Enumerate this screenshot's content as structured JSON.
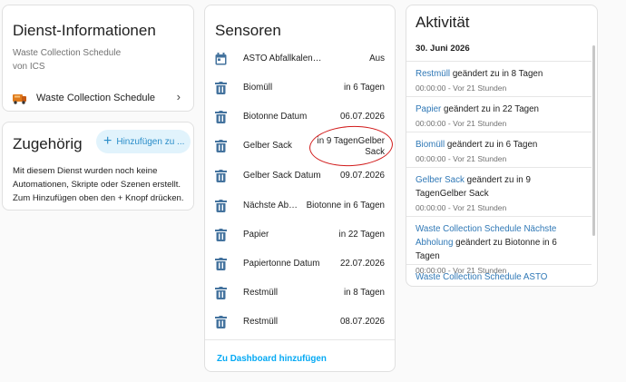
{
  "service_card": {
    "title": "Dienst-Informationen",
    "integration": "Waste Collection Schedule",
    "provider": "von ICS",
    "entry_label": "Waste Collection Schedule"
  },
  "related_card": {
    "title": "Zugehörig",
    "add_button": "Hinzufügen zu ...",
    "description": "Mit diesem Dienst wurden noch keine Automationen, Skripte oder Szenen erstellt. Zum Hinzufügen oben den + Knopf drücken."
  },
  "sensors_card": {
    "title": "Sensoren",
    "items": [
      {
        "icon": "calendar-icon",
        "name": "ASTO Abfallkalender",
        "value": "Aus"
      },
      {
        "icon": "trash-can-icon",
        "name": "Biomüll",
        "value": "in 6 Tagen"
      },
      {
        "icon": "trash-can-icon",
        "name": "Biotonne Datum",
        "value": "06.07.2026"
      },
      {
        "icon": "trash-can-icon",
        "name": "Gelber Sack",
        "value": "in 9 TagenGelber Sack"
      },
      {
        "icon": "trash-can-icon",
        "name": "Gelber Sack Datum",
        "value": "09.07.2026"
      },
      {
        "icon": "trash-can-icon",
        "name": "Nächste Abholung",
        "value": "Biotonne in 6 Tagen"
      },
      {
        "icon": "trash-can-icon",
        "name": "Papier",
        "value": "in 22 Tagen"
      },
      {
        "icon": "trash-can-icon",
        "name": "Papiertonne Datum",
        "value": "22.07.2026"
      },
      {
        "icon": "trash-can-icon",
        "name": "Restmüll",
        "value": "in 8 Tagen"
      },
      {
        "icon": "trash-can-icon",
        "name": "Restmüll",
        "value": "08.07.2026"
      }
    ],
    "dashboard_link": "Zu Dashboard hinzufügen"
  },
  "activity_card": {
    "title": "Aktivität",
    "date": "30. Juni 2026",
    "entries": [
      {
        "entity": "Restmüll",
        "text": " geändert zu in 8 Tagen",
        "time": "00:00:00 - Vor 21 Stunden"
      },
      {
        "entity": "Papier",
        "text": " geändert zu in 22 Tagen",
        "time": "00:00:00 - Vor 21 Stunden"
      },
      {
        "entity": "Biomüll",
        "text": " geändert zu in 6 Tagen",
        "time": "00:00:00 - Vor 21 Stunden"
      },
      {
        "entity": "Gelber Sack",
        "text": " geändert zu in 9 TagenGelber Sack",
        "time": "00:00:00 - Vor 21 Stunden"
      },
      {
        "entity": "Waste Collection Schedule Nächste Abholung",
        "text": " geändert zu Biotonne in 6 Tagen",
        "time": "00:00:00 - Vor 21 Stunden"
      },
      {
        "entity": "Waste Collection Schedule ASTO",
        "text": "",
        "time": ""
      }
    ]
  },
  "colors": {
    "accent": "#03a9f4",
    "link": "#2f78b6",
    "annotation": "#d11a1a"
  }
}
